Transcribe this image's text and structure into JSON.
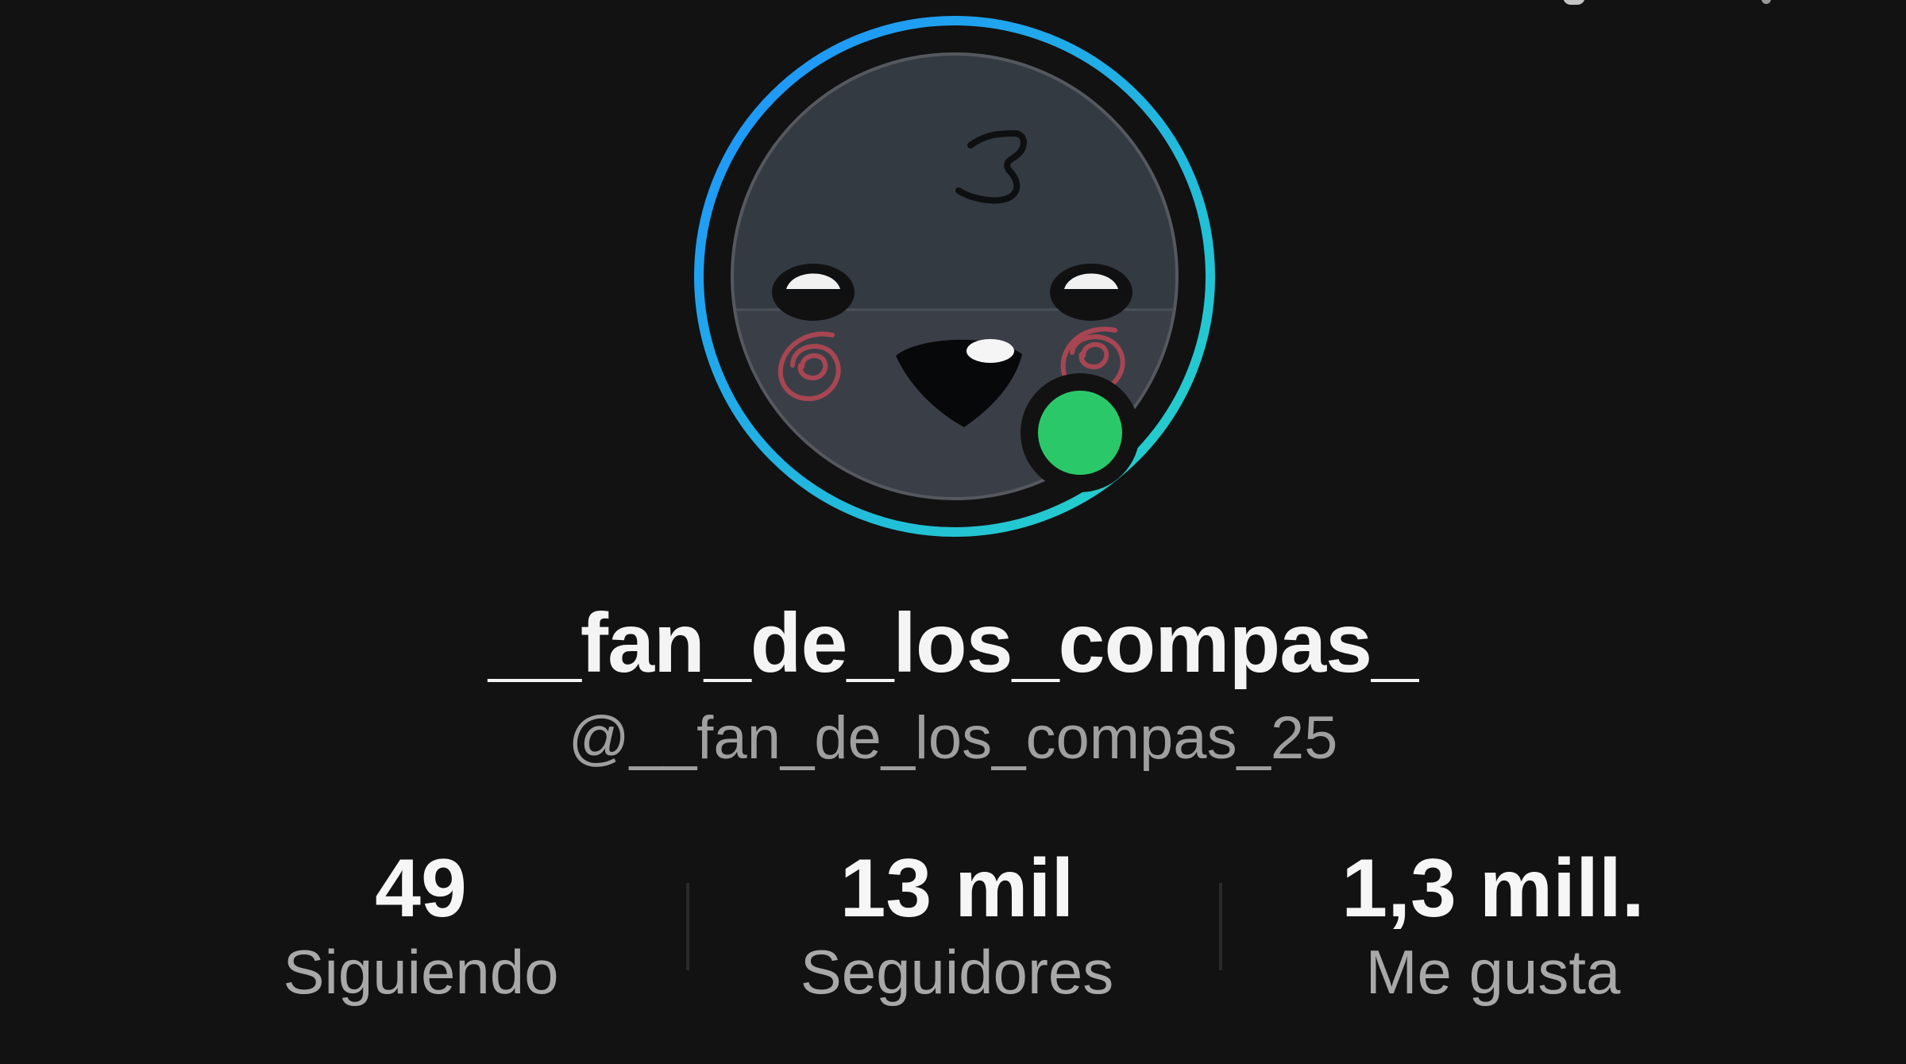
{
  "profile": {
    "display_name": "__fan_de_los_compas_",
    "handle": "@__fan_de_los_compas_25",
    "avatar_icon": "kawaii-face-avatar",
    "online_status_icon": "online-status-dot",
    "ring_gradient": [
      "#1e90ff",
      "#24d5c5"
    ],
    "online_color": "#2bc86a"
  },
  "stats": {
    "following_value": "49",
    "following_label": "Siguiendo",
    "followers_value": "13 mil",
    "followers_label": "Seguidores",
    "likes_value": "1,3 mill.",
    "likes_label": "Me gusta"
  }
}
